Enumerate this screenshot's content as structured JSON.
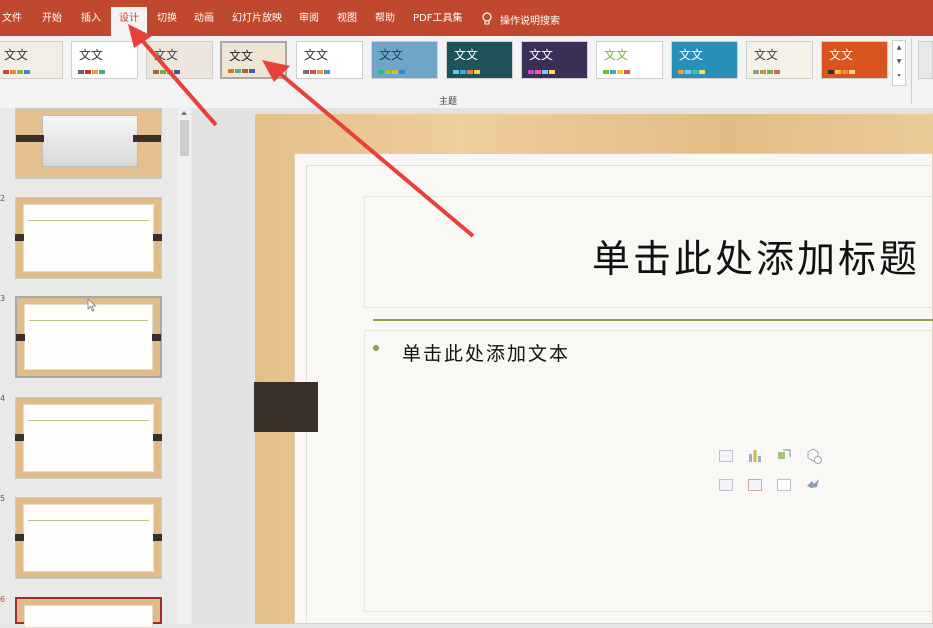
{
  "ribbon": {
    "tabs": [
      {
        "label": "文件"
      },
      {
        "label": "开始"
      },
      {
        "label": "插入"
      },
      {
        "label": "设计",
        "active": true
      },
      {
        "label": "切换"
      },
      {
        "label": "动画"
      },
      {
        "label": "幻灯片放映"
      },
      {
        "label": "审阅"
      },
      {
        "label": "视图"
      },
      {
        "label": "帮助"
      },
      {
        "label": "PDF工具集"
      }
    ],
    "search_label": "操作说明搜索",
    "group_label": "主题",
    "themes": [
      {
        "label": "文文",
        "bg": "#f4efe4",
        "color": "#333"
      },
      {
        "label": "文文",
        "bg": "#ffffff",
        "color": "#333"
      },
      {
        "label": "文文",
        "bg": "#ece6dc",
        "color": "#444"
      },
      {
        "label": "文文",
        "bg": "#efe5d4",
        "color": "#222",
        "selected": true
      },
      {
        "label": "文文",
        "bg": "#ffffff",
        "color": "#333"
      },
      {
        "label": "文文",
        "bg": "#6fa6c8",
        "color": "#1b3f59"
      },
      {
        "label": "文文",
        "bg": "#1f5259",
        "color": "#ffffff"
      },
      {
        "label": "文文",
        "bg": "#3b2f57",
        "color": "#ffffff"
      },
      {
        "label": "文文",
        "bg": "#ffffff",
        "color": "#7db82f"
      },
      {
        "label": "文文",
        "bg": "#2a8fb8",
        "color": "#ffffff"
      },
      {
        "label": "文文",
        "bg": "#f4f1e6",
        "color": "#444"
      },
      {
        "label": "文文",
        "bg": "#d9541f",
        "color": "#ffffff"
      }
    ]
  },
  "slides_panel": {
    "slides": [
      {
        "number": ""
      },
      {
        "number": "2"
      },
      {
        "number": "3"
      },
      {
        "number": "4"
      },
      {
        "number": "5"
      },
      {
        "number": "6"
      }
    ]
  },
  "slide": {
    "title_placeholder": "单击此处添加标题",
    "body_placeholder": "单击此处添加文本"
  },
  "colors": {
    "accent": "#c0482e",
    "annotation_arrow": "#e8403b",
    "bullet_green": "#8aa24a"
  },
  "icons": [
    "table-icon",
    "chart-icon",
    "smartart-icon",
    "3d-model-icon",
    "picture-icon",
    "online-picture-icon",
    "video-icon",
    "icons-icon"
  ]
}
